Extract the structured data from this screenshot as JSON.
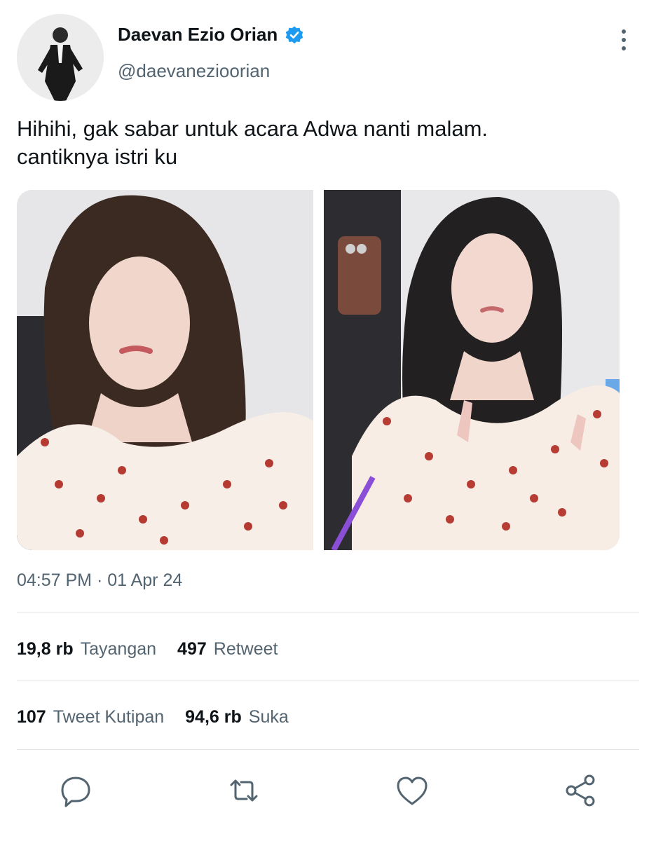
{
  "author": {
    "display_name": "Daevan Ezio Orian",
    "handle": "@daevanezioorian"
  },
  "tweet": {
    "text_lines": [
      "Hihihi, gak sabar untuk acara Adwa nanti malam.",
      "cantiknya istri ku"
    ],
    "timestamp": "04:57 PM · 01 Apr 24"
  },
  "stats": {
    "views": {
      "count": "19,8 rb",
      "label": "Tayangan"
    },
    "retweets": {
      "count": "497",
      "label": "Retweet"
    },
    "quotes": {
      "count": "107",
      "label": "Tweet Kutipan"
    },
    "likes": {
      "count": "94,6 rb",
      "label": "Suka"
    }
  },
  "icons": {
    "verified": "verified-badge-icon",
    "more": "more-vertical-icon",
    "reply": "reply-icon",
    "retweet": "retweet-icon",
    "like": "heart-icon",
    "share": "share-icon"
  },
  "colors": {
    "verified": "#1d9bf0",
    "text": "#0f1419",
    "secondary": "#536471",
    "divider": "#e1e4e8"
  }
}
